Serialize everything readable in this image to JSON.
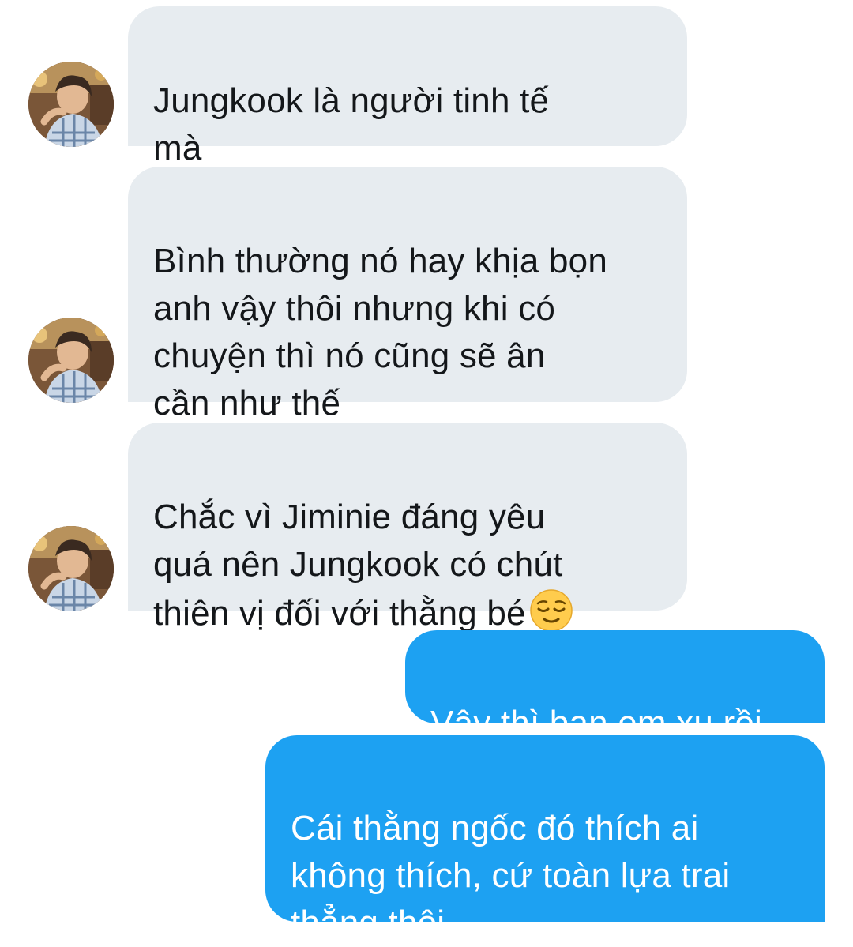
{
  "conversation": {
    "incoming": [
      {
        "text": "Jungkook là người tinh tế\nmà"
      },
      {
        "text": "Bình thường nó hay khịa bọn\nanh vậy thôi nhưng khi có\nchuyện thì nó cũng sẽ ân\ncần như thế"
      },
      {
        "text": "Chắc vì Jiminie đáng yêu\nquá nên Jungkook có chút\nthiên vị đối với thằng bé",
        "emoji": "relieved-face"
      }
    ],
    "outgoing": [
      {
        "text": "Vậy thì bạn em xu rồi"
      },
      {
        "text": "Cái thằng ngốc đó thích ai\nkhông thích, cứ toàn lựa trai\nthẳng thôi"
      }
    ]
  },
  "colors": {
    "incoming_bubble": "#e7ecf0",
    "incoming_text": "#14171a",
    "outgoing_bubble": "#1da1f2",
    "outgoing_text": "#ffffff",
    "background": "#ffffff"
  }
}
